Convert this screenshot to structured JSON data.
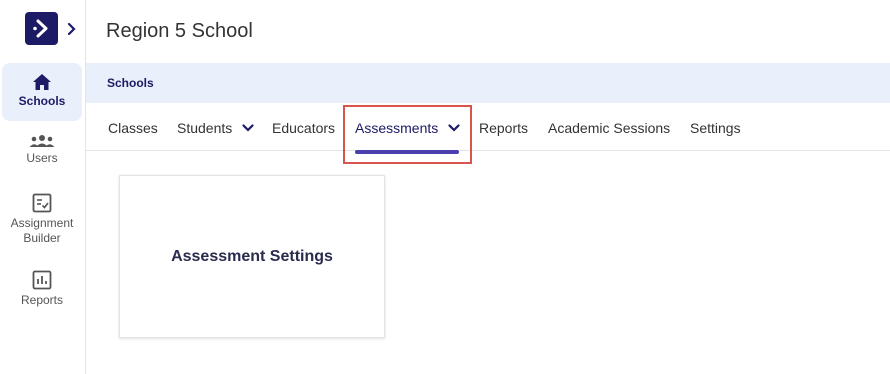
{
  "sidebar": {
    "items": [
      {
        "label": "Schools",
        "icon": "home-icon"
      },
      {
        "label": "Users",
        "icon": "users-icon"
      },
      {
        "label": "Assignment Builder",
        "icon": "assignment-icon"
      },
      {
        "label": "Reports",
        "icon": "reports-icon"
      }
    ]
  },
  "header": {
    "title": "Region 5 School"
  },
  "breadcrumb": {
    "label": "Schools"
  },
  "tabs": [
    {
      "label": "Classes"
    },
    {
      "label": "Students"
    },
    {
      "label": "Educators"
    },
    {
      "label": "Assessments",
      "active": true
    },
    {
      "label": "Reports"
    },
    {
      "label": "Academic Sessions"
    },
    {
      "label": "Settings"
    }
  ],
  "cards": [
    {
      "title": "Assessment Settings"
    }
  ],
  "colors": {
    "brand": "#1d1a66",
    "accent": "#4b3fb0",
    "breadcrumb_bg": "#eaf0fb",
    "highlight": "#d9534f"
  }
}
